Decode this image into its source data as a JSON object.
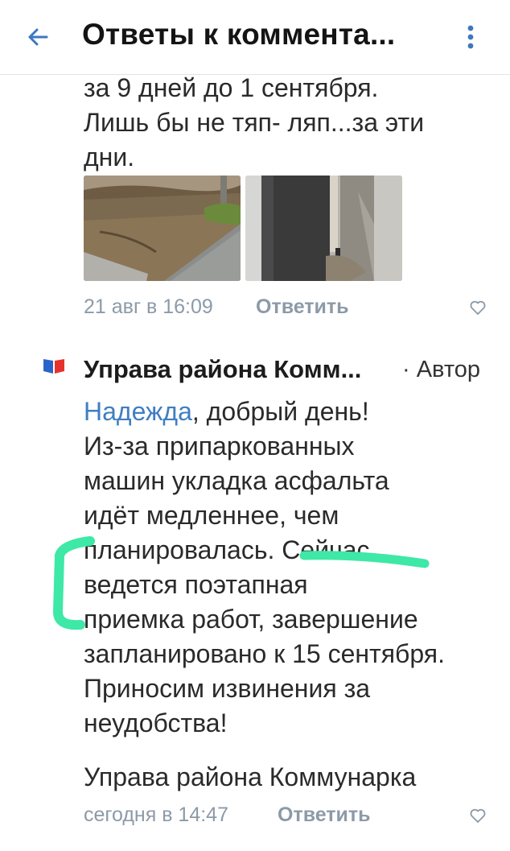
{
  "header": {
    "title": "Ответы к коммента...",
    "back_icon": "arrow-left-icon",
    "more_icon": "more-vertical-icon"
  },
  "comment1": {
    "lines": [
      "за 9 дней до 1 сентября.",
      "Лишь бы не тяп- ляп...за эти",
      "дни."
    ],
    "timestamp": "21 авг в 16:09",
    "reply_label": "Ответить",
    "like_icon": "heart-outline-icon"
  },
  "comment2": {
    "author": "Управа района Комм...",
    "author_badge": "· Автор",
    "mention": "Надежда",
    "lines": [
      ", добрый день!",
      "Из-за припаркованных",
      "машин укладка асфальта",
      "идёт медленнее, чем",
      "планировалась. Сейчас",
      "ведется поэтапная",
      "приемка работ, завершение",
      "запланировано к 15 сентября.",
      "Приносим извинения за",
      "неудобства!"
    ],
    "signature": "Управа района Коммунарка",
    "timestamp": "сегодня в 14:47",
    "reply_label": "Ответить",
    "like_icon": "heart-outline-icon"
  },
  "colors": {
    "accent_link": "#3f7ec2",
    "meta_grey": "#8c9aa8",
    "highlight_green": "#3ee8a6"
  }
}
